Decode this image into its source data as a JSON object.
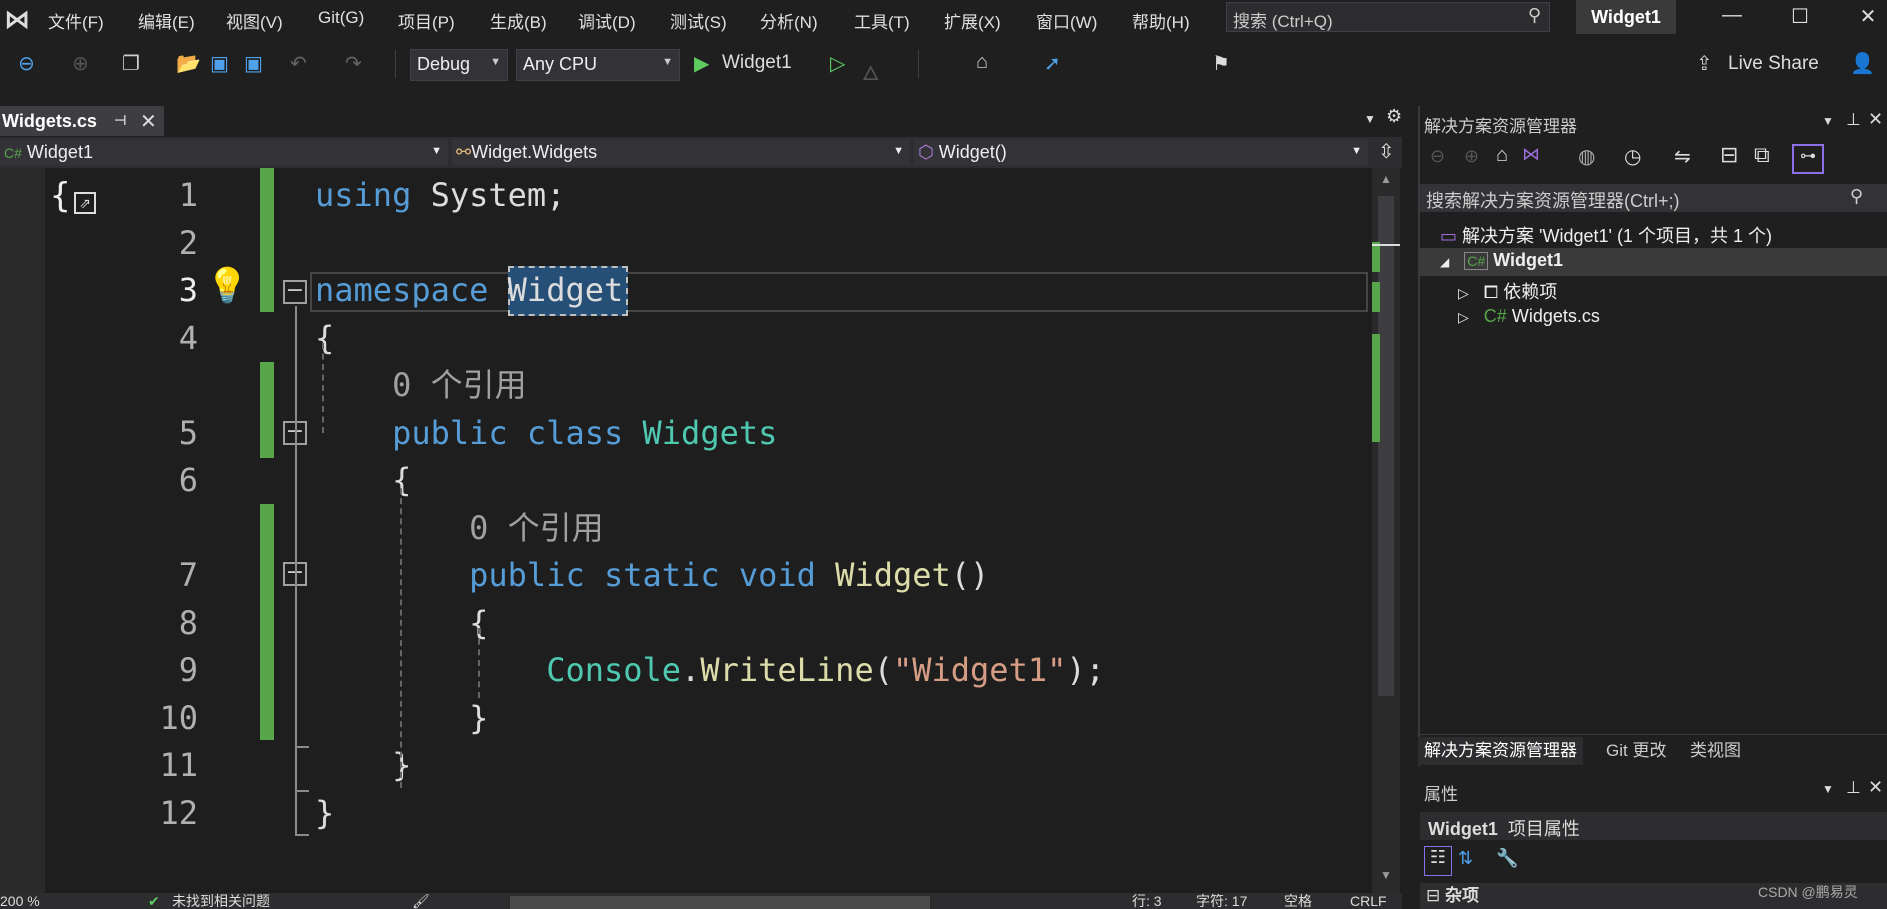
{
  "menubar": {
    "items": [
      "文件(F)",
      "编辑(E)",
      "视图(V)",
      "Git(G)",
      "项目(P)",
      "生成(B)",
      "调试(D)",
      "测试(S)",
      "分析(N)",
      "工具(T)",
      "扩展(X)",
      "窗口(W)",
      "帮助(H)"
    ],
    "search_placeholder": "搜索 (Ctrl+Q)",
    "window_title": "Widget1"
  },
  "toolbar": {
    "config": "Debug",
    "platform": "Any CPU",
    "start_target": "Widget1",
    "live_share": "Live Share"
  },
  "doc_tab": {
    "label": "Widgets.cs"
  },
  "navbar": {
    "project": "Widget1",
    "type": "Widget.Widgets",
    "member": "Widget()"
  },
  "editor": {
    "rows": [
      {
        "ln": "1",
        "tokens": [
          {
            "t": "using ",
            "c": "kw"
          },
          {
            "t": "System;",
            "c": "pl"
          }
        ]
      },
      {
        "ln": "2",
        "tokens": []
      },
      {
        "ln": "3",
        "tokens": [
          {
            "t": "namespace ",
            "c": "kw"
          },
          {
            "t": "Widget",
            "c": "pl"
          }
        ]
      },
      {
        "ln": "4",
        "tokens": [
          {
            "t": "{",
            "c": "pl"
          }
        ]
      },
      {
        "ln": "",
        "tokens": [
          {
            "t": "    0 个引用",
            "c": "cl"
          }
        ]
      },
      {
        "ln": "5",
        "tokens": [
          {
            "t": "    public class ",
            "c": "kw"
          },
          {
            "t": "Widgets",
            "c": "ty"
          }
        ]
      },
      {
        "ln": "6",
        "tokens": [
          {
            "t": "    {",
            "c": "pl"
          }
        ]
      },
      {
        "ln": "",
        "tokens": [
          {
            "t": "        0 个引用",
            "c": "cl"
          }
        ]
      },
      {
        "ln": "7",
        "tokens": [
          {
            "t": "        public static void ",
            "c": "kw"
          },
          {
            "t": "Widget",
            "c": "me"
          },
          {
            "t": "()",
            "c": "pl"
          }
        ]
      },
      {
        "ln": "8",
        "tokens": [
          {
            "t": "        {",
            "c": "pl"
          }
        ]
      },
      {
        "ln": "9",
        "tokens": [
          {
            "t": "            Console",
            "c": "ty"
          },
          {
            "t": ".",
            "c": "pl"
          },
          {
            "t": "WriteLine",
            "c": "me"
          },
          {
            "t": "(",
            "c": "pl"
          },
          {
            "t": "\"Widget1\"",
            "c": "st"
          },
          {
            "t": ");",
            "c": "pl"
          }
        ]
      },
      {
        "ln": "10",
        "tokens": [
          {
            "t": "        }",
            "c": "pl"
          }
        ]
      },
      {
        "ln": "11",
        "tokens": [
          {
            "t": "    }",
            "c": "pl"
          }
        ]
      },
      {
        "ln": "12",
        "tokens": [
          {
            "t": "}",
            "c": "pl"
          }
        ]
      }
    ]
  },
  "statusbar": {
    "zoom": "200 %",
    "issues": "未找到相关问题",
    "line": "行: 3",
    "char": "字符: 17",
    "spaces": "空格",
    "eol": "CRLF"
  },
  "solution_explorer": {
    "title": "解决方案资源管理器",
    "search_placeholder": "搜索解决方案资源管理器(Ctrl+;)",
    "solution": "解决方案 'Widget1' (1 个项目，共 1 个)",
    "project": "Widget1",
    "deps": "依赖项",
    "file": "Widgets.cs",
    "tabs": [
      "解决方案资源管理器",
      "Git 更改",
      "类视图"
    ]
  },
  "properties": {
    "title": "属性",
    "object": "Widget1",
    "object_type": "项目属性",
    "category": "杂项"
  },
  "watermark": "CSDN @鹏易灵"
}
